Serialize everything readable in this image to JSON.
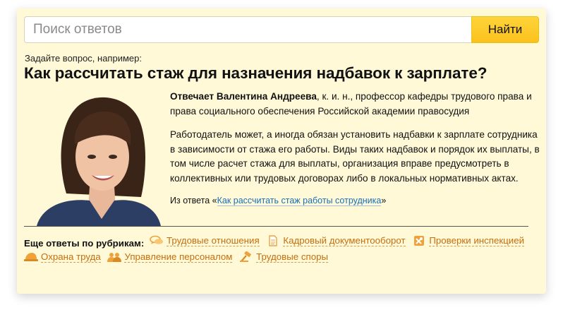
{
  "search": {
    "placeholder": "Поиск ответов",
    "button_label": "Найти"
  },
  "hint": "Задайте вопрос, например:",
  "question": "Как рассчитать стаж для назначения надбавок к зарплате?",
  "author": {
    "name": "Отвечает Валентина Андреева",
    "credentials": ", к. и. н., профессор кафедры трудового права и права социального обеспечения Российской академии правосудия"
  },
  "answer_text": "Работодатель может, а иногда обязан установить надбавки к зарплате сотрудника в зависимости от стажа его работы. Виды таких надбавок и порядок их выплаты, в том числе расчет стажа для выплаты, организация вправе предусмотреть в коллективных или трудовых договорах либо в локальных нормативных актах.",
  "source": {
    "prefix": "Из ответа «",
    "link_text": "Как рассчитать стаж работы сотрудника",
    "suffix": "»"
  },
  "rubrics": {
    "title": "Еще ответы по рубрикам:",
    "items": [
      {
        "label": "Трудовые отношения",
        "icon": "speech-bubbles-icon"
      },
      {
        "label": "Кадровый документооборот",
        "icon": "document-icon"
      },
      {
        "label": "Проверки инспекцией",
        "icon": "hammer-wrench-icon"
      },
      {
        "label": "Охрана труда",
        "icon": "hard-hat-icon"
      },
      {
        "label": "Управление персоналом",
        "icon": "people-icon"
      },
      {
        "label": "Трудовые споры",
        "icon": "gavel-icon"
      }
    ],
    "accent_color": "#c56e0e",
    "icon_color": "#f0a23a"
  }
}
